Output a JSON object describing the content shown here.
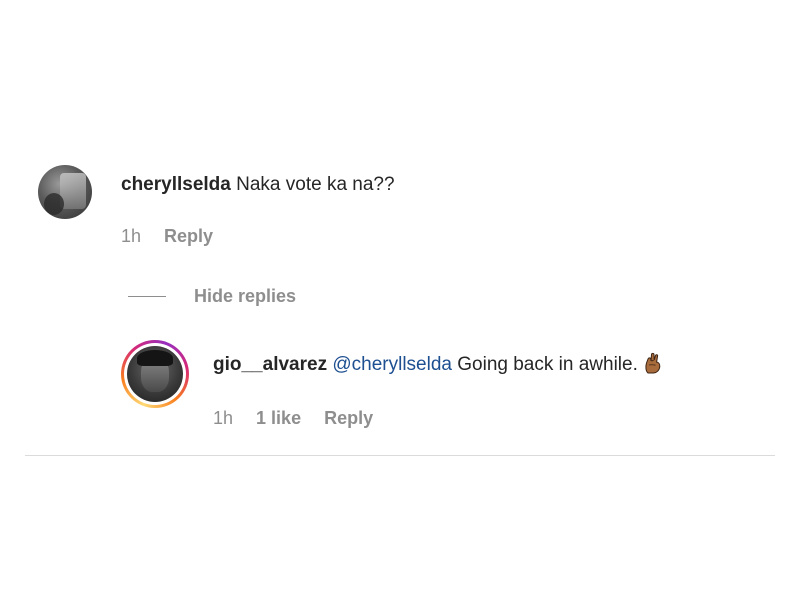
{
  "comment": {
    "username": "cheryllselda",
    "text": "Naka vote ka na??",
    "time": "1h",
    "reply_label": "Reply"
  },
  "hide_replies": {
    "label": "Hide replies"
  },
  "reply": {
    "username": "gio__alvarez",
    "mention": "@cheryllselda",
    "text": "Going back in awhile.",
    "emoji_icon": "fingers-crossed-emoji",
    "time": "1h",
    "likes": "1 like",
    "reply_label": "Reply"
  },
  "colors": {
    "text": "#262626",
    "muted": "#8e8e8e",
    "mention": "#1d4f91",
    "divider": "#dbdbdb"
  }
}
